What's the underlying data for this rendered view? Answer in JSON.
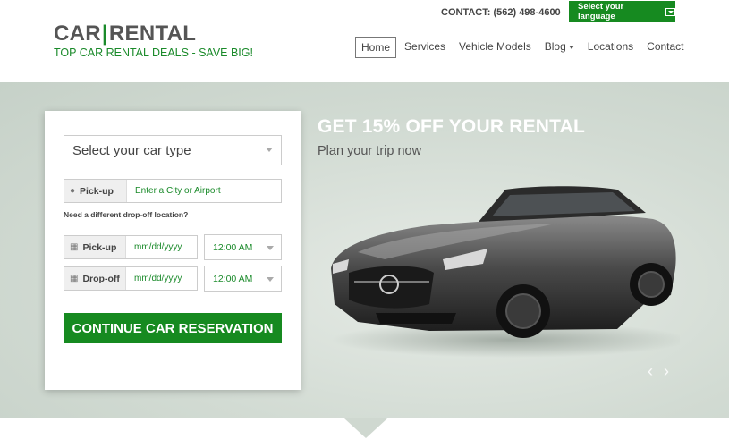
{
  "brand": {
    "logo_left": "CAR",
    "logo_sep": "|",
    "logo_right": "RENTAL",
    "tagline": "TOP CAR RENTAL DEALS - SAVE BIG!"
  },
  "contact": "CONTACT: (562) 498-4600",
  "language_button": "Select your language",
  "nav": [
    "Home",
    "Services",
    "Vehicle Models",
    "Blog",
    "Locations",
    "Contact"
  ],
  "promo": {
    "title": "GET 15% OFF YOUR RENTAL",
    "subtitle": "Plan your trip now"
  },
  "form": {
    "car_type_placeholder": "Select your car type",
    "pickup_label": "Pick-up",
    "pickup_location_placeholder": "Enter a City or Airport",
    "dropoff_note": "Need a different drop-off location?",
    "pickup_date_label": "Pick-up",
    "pickup_date": "mm/dd/yyyy",
    "pickup_time": "12:00 AM",
    "dropoff_date_label": "Drop-off",
    "dropoff_date": "mm/dd/yyyy",
    "dropoff_time": "12:00 AM",
    "cta": "CONTINUE CAR RESERVATION"
  },
  "colors": {
    "brand_green": "#168a20",
    "hero_bg": "#d2dbd3"
  },
  "icons": [
    "map-pin-icon",
    "calendar-icon",
    "chevron-left-icon",
    "chevron-right-icon",
    "dropdown-icon"
  ]
}
